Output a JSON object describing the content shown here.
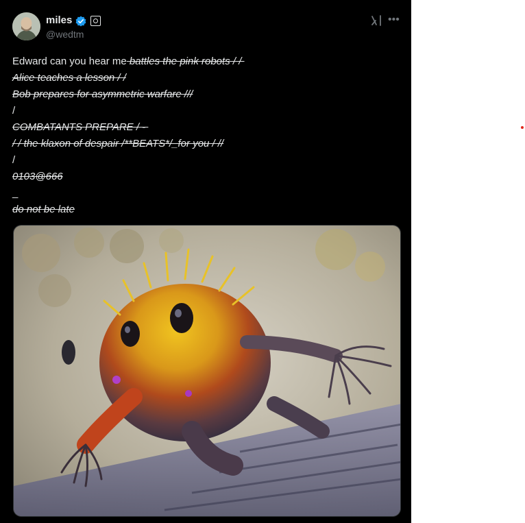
{
  "author": {
    "display_name": "miles",
    "handle": "@wedtm"
  },
  "icons": {
    "verified": "verified-badge-icon",
    "affiliation": "affiliation-badge-icon",
    "grok": "grok-icon",
    "more": "more-options-icon"
  },
  "colors": {
    "background": "#000000",
    "text": "#e7e9ea",
    "muted": "#71767b",
    "verified": "#1d9bf0",
    "accent_dot": "#e0261b"
  },
  "post": {
    "lines": [
      {
        "plain": "Edward can you hear me",
        "struck": " battles the pink robots / / "
      },
      {
        "plain": "",
        "struck": "Alice teaches a lesson / /"
      },
      {
        "plain": "",
        "struck": "Bob prepares for asymmetric warfare ///"
      },
      {
        "plain": "/",
        "struck": ""
      },
      {
        "plain": "",
        "struck": "COMBATANTS PREPARE / - "
      },
      {
        "plain": "",
        "struck": "/ / the klaxon of despair /**BEATS*/_for you / //"
      },
      {
        "plain": "/",
        "struck": ""
      },
      {
        "plain": "",
        "struck": "0103@666"
      },
      {
        "plain": "_",
        "struck": ""
      },
      {
        "plain": "",
        "struck": "do not be late"
      }
    ]
  },
  "media": {
    "alt": "yellow spiky creature image"
  }
}
